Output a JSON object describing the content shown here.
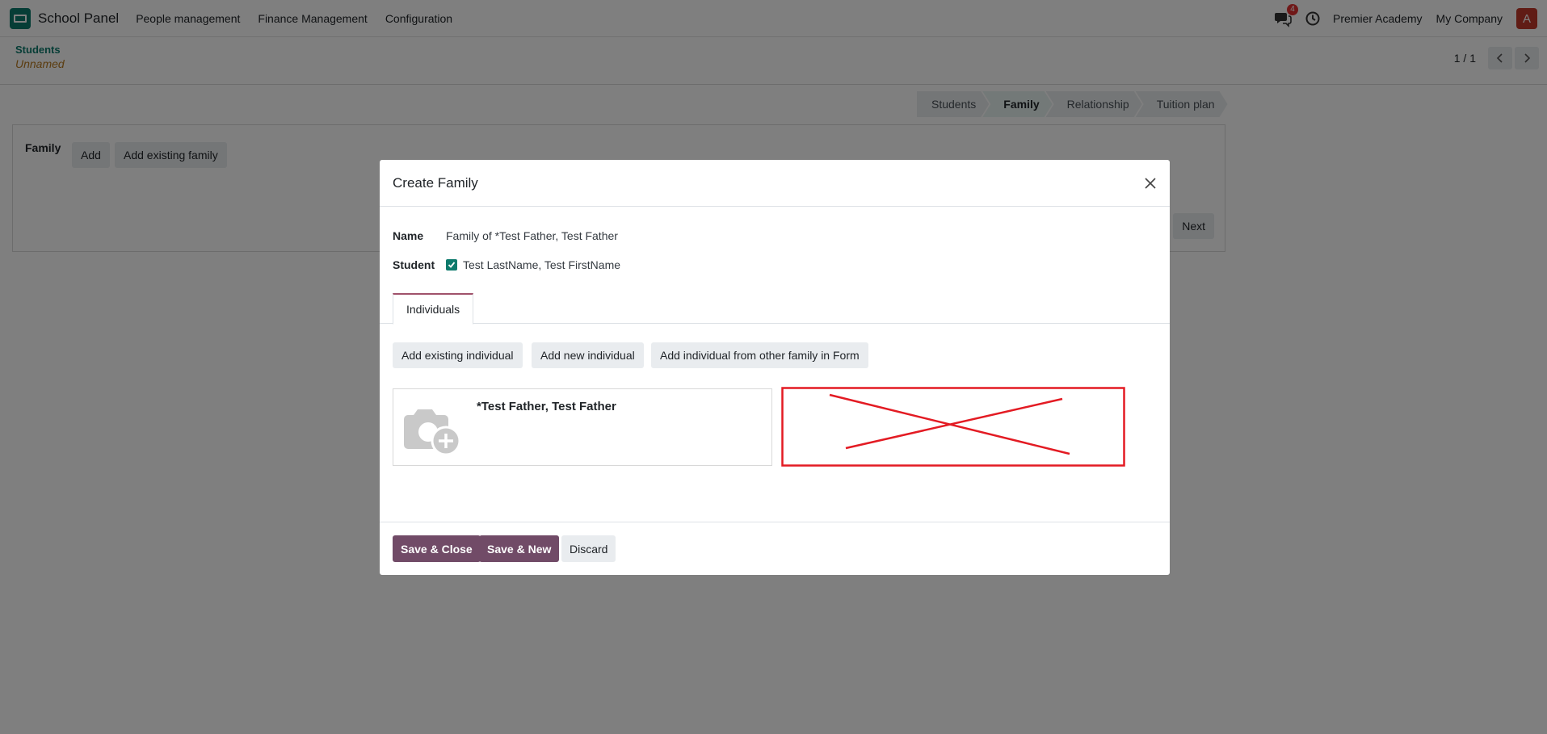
{
  "navbar": {
    "app_name": "School Panel",
    "menu": [
      "People management",
      "Finance Management",
      "Configuration"
    ],
    "chat_badge": "4",
    "company_current": "Premier Academy",
    "company_switch": "My Company",
    "avatar_initial": "A"
  },
  "control_panel": {
    "breadcrumb": "Students",
    "record_name": "Unnamed",
    "pager": "1 / 1"
  },
  "statusbar": {
    "stages": [
      "Students",
      "Family",
      "Relationship",
      "Tuition plan"
    ],
    "active_stage": "Family"
  },
  "sheet": {
    "family_label": "Family",
    "add_label": "Add",
    "add_existing_family_label": "Add existing family",
    "next_label": "Next"
  },
  "modal": {
    "title": "Create Family",
    "name_label": "Name",
    "name_value": "Family of *Test Father, Test Father",
    "student_label": "Student",
    "student_value": "Test LastName, Test FirstName",
    "student_checked": true,
    "tab_individuals": "Individuals",
    "add_existing_individual": "Add existing individual",
    "add_new_individual": "Add new individual",
    "add_individual_other_family": "Add individual from other family in Form",
    "individual_card_name": "*Test Father, Test Father",
    "save_close": "Save & Close",
    "save_new": "Save & New",
    "discard": "Discard"
  },
  "colors": {
    "brand": "#0d7a6c",
    "primary_button": "#714b67",
    "annotation_red": "#e31b23"
  }
}
